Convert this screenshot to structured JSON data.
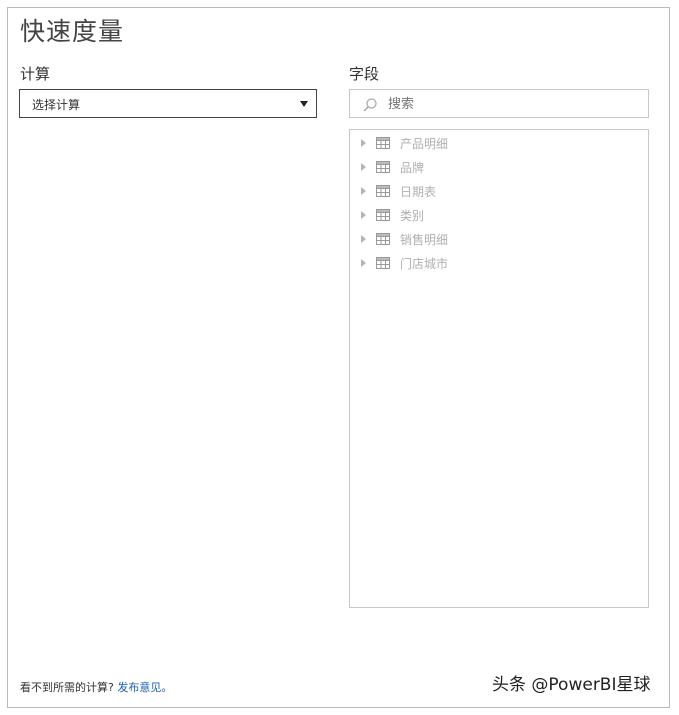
{
  "dialog": {
    "title": "快速度量",
    "calculation": {
      "label": "计算",
      "select_value": "选择计算"
    },
    "fields": {
      "label": "字段",
      "search_placeholder": "搜索",
      "items": [
        {
          "label": "产品明细"
        },
        {
          "label": "品牌"
        },
        {
          "label": "日期表"
        },
        {
          "label": "类别"
        },
        {
          "label": "销售明细"
        },
        {
          "label": "门店城市"
        }
      ]
    },
    "footer": {
      "text": "看不到所需的计算?",
      "link": "发布意见。"
    }
  },
  "watermark": "头条 @PowerBI星球",
  "colors": {
    "link": "#1f5fa8",
    "disabled_text": "#b0b0b0"
  }
}
